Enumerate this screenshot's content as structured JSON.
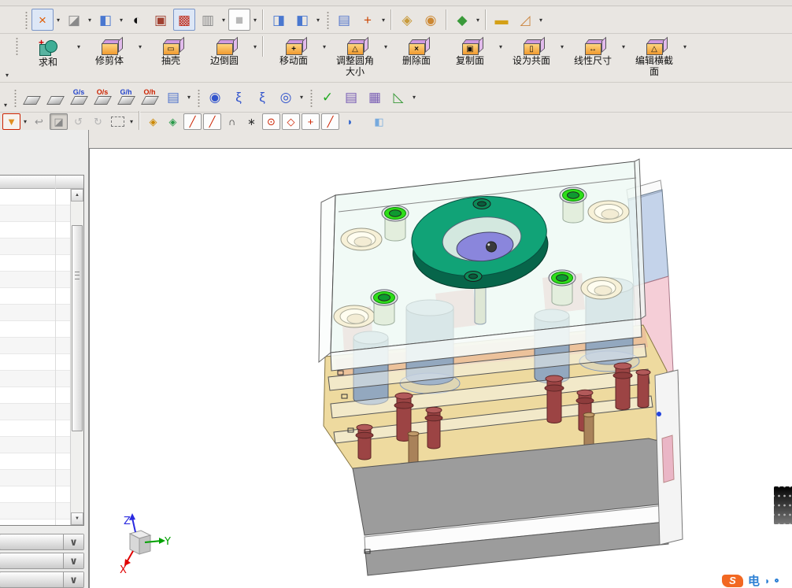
{
  "window": {
    "background": "#e9e6e2"
  },
  "colors": {
    "toolbar_bg": "#e9e6e2",
    "selection_box": "#7a96c8",
    "panel_bg": "#ececeb",
    "viewport_bg": "#ffffff"
  },
  "toolbars": {
    "row1": {
      "name": "view-toolbar",
      "items": [
        {
          "t": "grip"
        },
        {
          "t": "b",
          "name": "fit-view-button",
          "g": "×",
          "c": "#e05a00",
          "cls": "boxed"
        },
        {
          "t": "dd",
          "name": "fit-view-dropdown"
        },
        {
          "t": "b",
          "name": "shaded-view-button",
          "g": "◪",
          "c": "#8a8a8a"
        },
        {
          "t": "dd",
          "name": "shaded-view-dropdown"
        },
        {
          "t": "b",
          "name": "isometric-view-button",
          "g": "◧",
          "c": "#4a78d0"
        },
        {
          "t": "dd",
          "name": "isometric-view-dropdown"
        },
        {
          "t": "b",
          "name": "render-style-button",
          "g": "◐",
          "c": "#111111"
        },
        {
          "t": "b",
          "name": "wireframe-in-cube-button",
          "g": "▣",
          "c": "#a04030"
        },
        {
          "t": "b",
          "name": "shaded-in-cube-button",
          "g": "▩",
          "c": "#c03020",
          "cls": "boxed"
        },
        {
          "t": "b",
          "name": "translucent-cube-button",
          "g": "▥",
          "c": "#888888"
        },
        {
          "t": "dd",
          "name": "cube-display-dropdown"
        },
        {
          "t": "b",
          "name": "background-color-button",
          "g": "■",
          "c": "#b8b8b8",
          "cls": "bordered"
        },
        {
          "t": "dd",
          "name": "background-dropdown"
        },
        {
          "t": "sep"
        },
        {
          "t": "b",
          "name": "clip-section-button",
          "g": "◨",
          "c": "#4a78d0"
        },
        {
          "t": "b",
          "name": "clip-plane-button",
          "g": "◧",
          "c": "#4a78d0"
        },
        {
          "t": "dd",
          "name": "clip-dropdown"
        },
        {
          "t": "grip"
        },
        {
          "t": "b",
          "name": "layer-settings-button",
          "g": "▤",
          "c": "#5577cc"
        },
        {
          "t": "b",
          "name": "wcs-display-button",
          "g": "+",
          "c": "#cc4400"
        },
        {
          "t": "dd",
          "name": "wcs-dropdown"
        },
        {
          "t": "sep"
        },
        {
          "t": "b",
          "name": "move-object-button",
          "g": "◈",
          "c": "#c89a3a"
        },
        {
          "t": "b",
          "name": "object-display-button",
          "g": "◉",
          "c": "#cc8833"
        },
        {
          "t": "sep"
        },
        {
          "t": "b",
          "name": "show-hide-button",
          "g": "◆",
          "c": "#3a9a3a"
        },
        {
          "t": "dd",
          "name": "show-hide-dropdown"
        },
        {
          "t": "sep"
        },
        {
          "t": "b",
          "name": "linear-ruler-button",
          "g": "▬",
          "c": "#d4a017"
        },
        {
          "t": "b",
          "name": "angle-ruler-button",
          "g": "◿",
          "c": "#cc8844"
        },
        {
          "t": "dd",
          "name": "measure-dropdown"
        }
      ]
    },
    "row2": {
      "name": "feature-toolbar",
      "items": [
        {
          "t": "ov",
          "name": "row2-overflow"
        },
        {
          "t": "grip"
        },
        {
          "t": "b",
          "big": 1,
          "name": "unite-button",
          "icon": "bool",
          "g": "+",
          "c": "#cc0000",
          "lab": "求和"
        },
        {
          "t": "dd",
          "name": "unite-dropdown"
        },
        {
          "t": "b",
          "big": 1,
          "name": "trim-body-button",
          "icon": "cube",
          "g": "",
          "lab": "修剪体"
        },
        {
          "t": "dd",
          "name": "trim-body-dropdown"
        },
        {
          "t": "b",
          "big": 1,
          "name": "shell-button",
          "icon": "cube",
          "g": "▭",
          "lab": "抽壳"
        },
        {
          "t": "b",
          "big": 1,
          "name": "edge-blend-button",
          "icon": "cube",
          "g": "",
          "lab": "边倒圆"
        },
        {
          "t": "dd",
          "name": "edge-blend-dropdown"
        },
        {
          "t": "sep"
        },
        {
          "t": "b",
          "big": 1,
          "name": "move-face-button",
          "icon": "cube",
          "g": "+",
          "lab": "移动面"
        },
        {
          "t": "dd",
          "name": "move-face-dropdown"
        },
        {
          "t": "b",
          "big": 1,
          "name": "resize-blend-button",
          "icon": "cube",
          "g": "△",
          "lab": "调整圆角",
          "lab2": "大小"
        },
        {
          "t": "dd",
          "name": "resize-blend-dropdown"
        },
        {
          "t": "b",
          "big": 1,
          "name": "delete-face-button",
          "icon": "cube",
          "g": "×",
          "lab": "删除面"
        },
        {
          "t": "b",
          "big": 1,
          "name": "copy-face-button",
          "icon": "cube",
          "g": "▣",
          "lab": "复制面"
        },
        {
          "t": "dd",
          "name": "copy-face-dropdown"
        },
        {
          "t": "b",
          "big": 1,
          "name": "make-coplanar-button",
          "icon": "cube",
          "g": "▯",
          "lab": "设为共面"
        },
        {
          "t": "dd",
          "name": "make-coplanar-dropdown"
        },
        {
          "t": "b",
          "big": 1,
          "name": "linear-dimension-button",
          "icon": "cube",
          "g": "↔",
          "lab": "线性尺寸"
        },
        {
          "t": "dd",
          "name": "linear-dimension-dropdown"
        },
        {
          "t": "b",
          "big": 1,
          "name": "edit-cross-section-button",
          "icon": "cube",
          "g": "△",
          "lab": "编辑横截",
          "lab2": "面"
        },
        {
          "t": "dd",
          "name": "edit-cross-section-dropdown"
        }
      ]
    },
    "row3": {
      "name": "mold-tools-toolbar",
      "items": [
        {
          "t": "ov",
          "name": "row3-overflow"
        },
        {
          "t": "grip"
        },
        {
          "t": "b",
          "name": "mold-tool-a-button",
          "icon": "mold",
          "g": "",
          "c": "#333333"
        },
        {
          "t": "b",
          "name": "mold-tool-b-button",
          "icon": "mold",
          "g": "",
          "c": "#333333"
        },
        {
          "t": "b",
          "name": "electrode-gs-button",
          "icon": "mold",
          "g": "G/s",
          "c": "#2244cc"
        },
        {
          "t": "b",
          "name": "electrode-os-button",
          "icon": "mold",
          "g": "O/s",
          "c": "#cc2200"
        },
        {
          "t": "b",
          "name": "electrode-gh-button",
          "icon": "mold",
          "g": "G/h",
          "c": "#2244cc"
        },
        {
          "t": "b",
          "name": "electrode-oh-button",
          "icon": "mold",
          "g": "O/h",
          "c": "#cc2200"
        },
        {
          "t": "b",
          "name": "standard-part-library-button",
          "g": "▤",
          "c": "#5577cc"
        },
        {
          "t": "dd",
          "name": "standard-part-dropdown"
        },
        {
          "t": "grip"
        },
        {
          "t": "b",
          "name": "cooling-coil-button",
          "g": "◉",
          "c": "#3355cc"
        },
        {
          "t": "b",
          "name": "spring-button",
          "g": "ξ",
          "c": "#3355cc"
        },
        {
          "t": "b",
          "name": "spring-trim-button",
          "g": "ξ",
          "c": "#3355cc"
        },
        {
          "t": "b",
          "name": "cooling-edit-button",
          "g": "◎",
          "c": "#3355cc"
        },
        {
          "t": "dd",
          "name": "cooling-dropdown"
        },
        {
          "t": "grip"
        },
        {
          "t": "b",
          "name": "validate-check-button",
          "g": "✓",
          "c": "#22aa22"
        },
        {
          "t": "b",
          "name": "part-navigator-button",
          "g": "▤",
          "c": "#7a5fb5"
        },
        {
          "t": "b",
          "name": "bom-table-button",
          "g": "▦",
          "c": "#7a5fb5"
        },
        {
          "t": "b",
          "name": "csys-orient-button",
          "g": "◺",
          "c": "#3a9a3a"
        },
        {
          "t": "dd",
          "name": "csys-orient-dropdown"
        }
      ]
    },
    "row4": {
      "name": "selection-snap-toolbar",
      "items": [
        {
          "t": "b",
          "name": "selection-filter-button",
          "g": "▼",
          "c": "#e09020",
          "cls": "redbox sm"
        },
        {
          "t": "dd",
          "name": "selection-filter-dropdown"
        },
        {
          "t": "b",
          "name": "undo-button",
          "g": "↩",
          "c": "#909090",
          "cls": "sm"
        },
        {
          "t": "b",
          "name": "shaded-toggle-button",
          "g": "◪",
          "c": "#888888",
          "cls": "sm pressed"
        },
        {
          "t": "b",
          "name": "rotate-ref-button",
          "g": "↺",
          "c": "#b5b5b5",
          "cls": "sm"
        },
        {
          "t": "b",
          "name": "orient-ref-button",
          "g": "↻",
          "c": "#b5b5b5",
          "cls": "sm"
        },
        {
          "t": "b",
          "name": "marquee-select-button",
          "icon": "marq",
          "g": "",
          "cls": "sm"
        },
        {
          "t": "dd",
          "name": "marquee-dropdown"
        },
        {
          "t": "sep"
        },
        {
          "t": "b",
          "name": "snap-point-button",
          "g": "◈",
          "c": "#cc8800",
          "cls": "sm"
        },
        {
          "t": "b",
          "name": "snap-rotate-button",
          "g": "◈",
          "c": "#2a9a4a",
          "cls": "sm"
        },
        {
          "t": "b",
          "name": "snap-end-point-button",
          "g": "╱",
          "c": "#cc2200",
          "cls": "sm bordered"
        },
        {
          "t": "b",
          "name": "snap-mid-point-button",
          "g": "╱",
          "c": "#cc2200",
          "cls": "sm bordered"
        },
        {
          "t": "b",
          "name": "snap-arc-button",
          "g": "∩",
          "c": "#333333",
          "cls": "sm"
        },
        {
          "t": "b",
          "name": "snap-pole-button",
          "g": "∗",
          "c": "#333333",
          "cls": "sm"
        },
        {
          "t": "b",
          "name": "snap-center-button",
          "g": "⊙",
          "c": "#cc2200",
          "cls": "sm bordered"
        },
        {
          "t": "b",
          "name": "snap-quadrant-button",
          "g": "◇",
          "c": "#cc2200",
          "cls": "sm bordered"
        },
        {
          "t": "b",
          "name": "snap-intersection-button",
          "g": "+",
          "c": "#cc2200",
          "cls": "sm bordered"
        },
        {
          "t": "b",
          "name": "snap-point-on-curve-button",
          "g": "╱",
          "c": "#cc2200",
          "cls": "sm bordered"
        },
        {
          "t": "b",
          "name": "snap-point-on-face-button",
          "g": "◗",
          "c": "#3366cc",
          "cls": "sm"
        },
        {
          "t": "gap"
        },
        {
          "t": "b",
          "name": "show-shaded-cube-button",
          "g": "◧",
          "c": "#77aadd",
          "cls": "sm"
        }
      ]
    }
  },
  "left_panel": {
    "list": {
      "row_count": 20
    },
    "scrollbar": {
      "up_glyph": "▲",
      "down_glyph": "▼"
    },
    "collapsed_sections": [
      {
        "name": "collapsed-section-1",
        "chevron": "∨"
      },
      {
        "name": "collapsed-section-2",
        "chevron": "∨"
      },
      {
        "name": "collapsed-section-3",
        "chevron": "∨"
      }
    ]
  },
  "viewport": {
    "triad": {
      "x": "X",
      "y": "Y",
      "z": "Z"
    },
    "watermark": {
      "logo_text": "S",
      "cn_text": "电",
      "crescent": "◗",
      "accent": "#f26822",
      "blue": "#2b7fd4"
    }
  },
  "model_colors": {
    "top_plate": "rgba(237,248,244,0.78)",
    "locating_ring": "#11a377",
    "ring_shadow": "#07654a",
    "sprue_blue": "#8a86dc",
    "screw_highlight": "#2ede19",
    "plate_a": "#eeda9f",
    "guide_pin": "#93a8bf",
    "return_pin": "#9c4444",
    "base": "#9c9c9c"
  }
}
